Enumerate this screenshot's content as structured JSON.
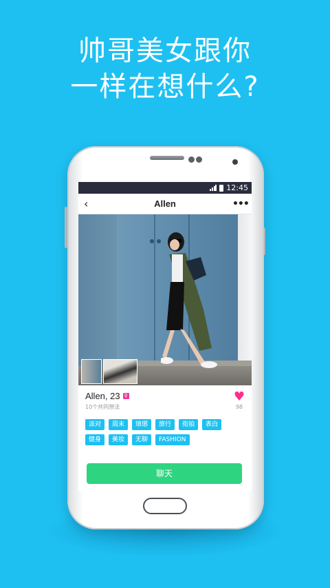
{
  "headline": {
    "line1": "帅哥美女跟你",
    "line2": "一样在想什么?"
  },
  "statusbar": {
    "time": "12:45"
  },
  "navbar": {
    "back_icon": "‹",
    "title": "Allen",
    "more_icon": "•••"
  },
  "profile": {
    "name_age": "Allen, 23",
    "gender_symbol": "♀",
    "common_thoughts": "10个共同想法",
    "like_count": "98"
  },
  "tags": [
    "派对",
    "周末",
    "琅琊",
    "旅行",
    "街拍",
    "表白",
    "健身",
    "美妆",
    "无聊",
    "FASHION"
  ],
  "chat_button": "聊天",
  "colors": {
    "background": "#1ec0f2",
    "tag": "#1ec0f2",
    "chat_button": "#2fd480",
    "heart": "#ff2d8a",
    "statusbar": "#2a2d3e"
  }
}
